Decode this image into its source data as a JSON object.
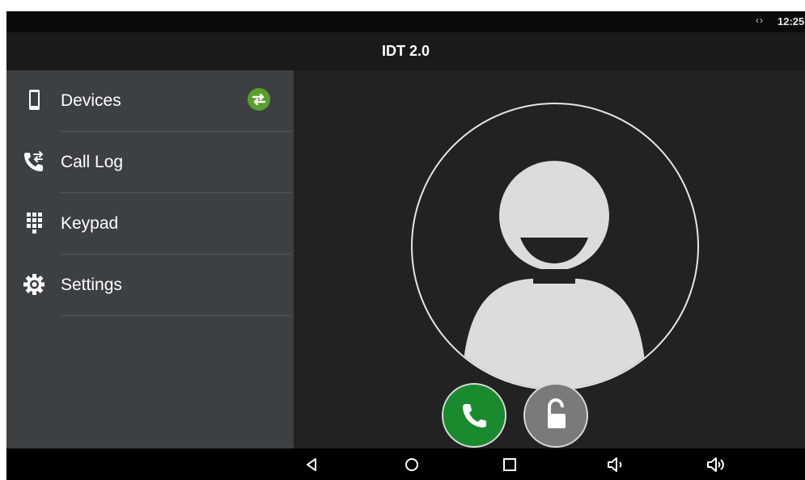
{
  "status_bar": {
    "time": "12:25",
    "connection_icon": "arrows-icon"
  },
  "app_bar": {
    "title": "IDT 2.0"
  },
  "sidebar": {
    "items": [
      {
        "label": "Devices",
        "icon": "phone-device-icon",
        "badge_icon": "sync-icon"
      },
      {
        "label": "Call Log",
        "icon": "call-log-icon"
      },
      {
        "label": "Keypad",
        "icon": "keypad-icon"
      },
      {
        "label": "Settings",
        "icon": "gear-icon"
      }
    ]
  },
  "main": {
    "avatar_icon": "person-avatar-icon",
    "actions": [
      {
        "name": "call",
        "icon": "phone-icon",
        "color": "#1a8a2e"
      },
      {
        "name": "unlock",
        "icon": "unlock-icon",
        "color": "#7a7a7a"
      }
    ]
  },
  "navigation_bar": {
    "buttons": [
      "back-icon",
      "home-icon",
      "recents-icon",
      "volume-down-icon",
      "volume-up-icon"
    ]
  },
  "colors": {
    "sidebar": "#3d4043",
    "main_bg": "#222222",
    "call_green": "#1a8a2e",
    "badge_green": "#5aa02c"
  }
}
